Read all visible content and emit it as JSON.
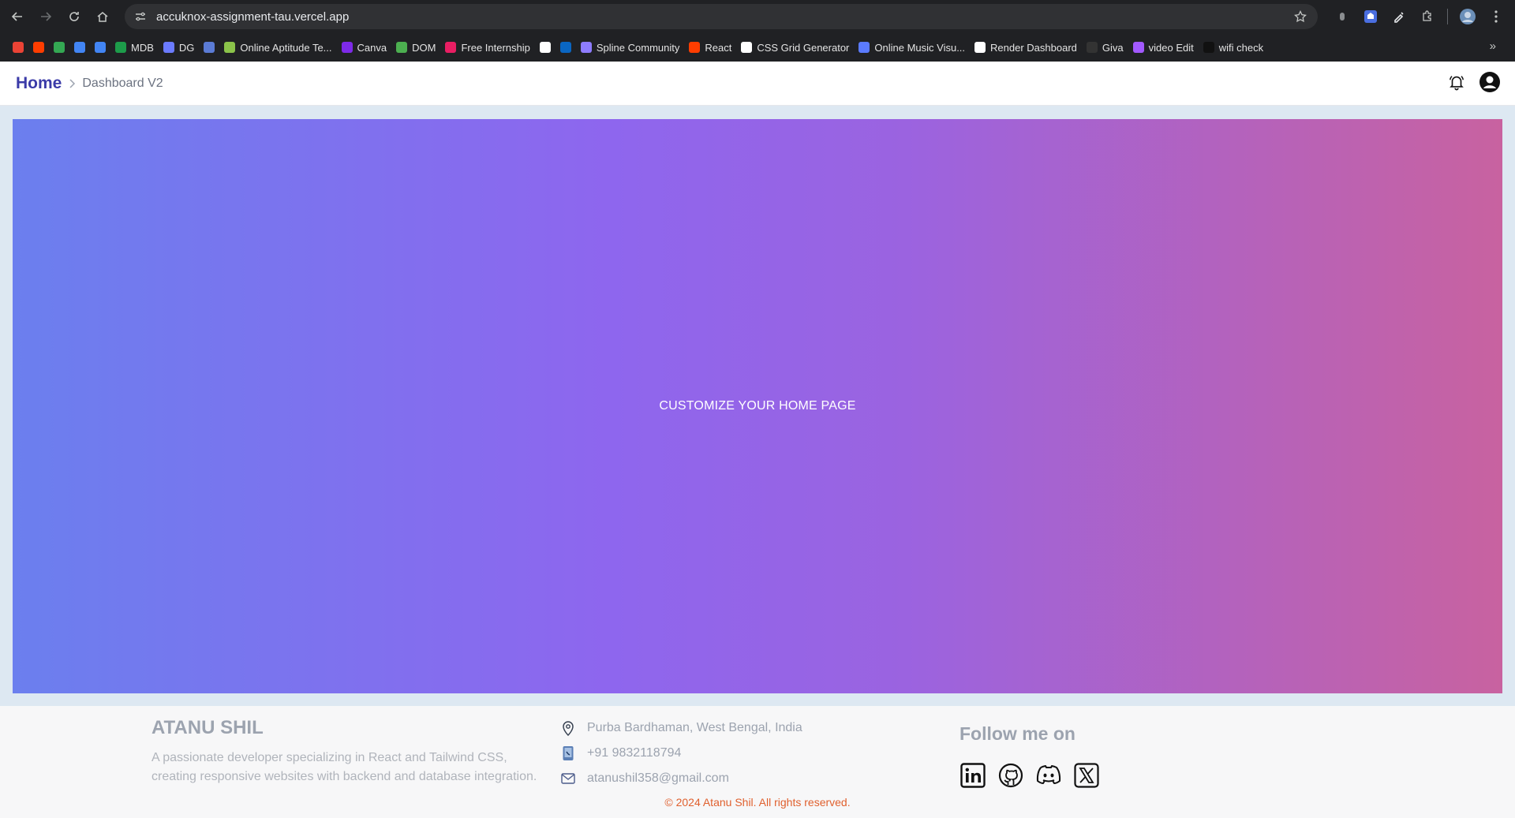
{
  "browser": {
    "url": "accuknox-assignment-tau.vercel.app",
    "bookmarks": [
      {
        "label": "",
        "color": "#ea4335"
      },
      {
        "label": "",
        "color": "#ff3d00"
      },
      {
        "label": "",
        "color": "#34a853"
      },
      {
        "label": "",
        "color": "#4285f4"
      },
      {
        "label": "",
        "color": "#4285f4"
      },
      {
        "label": "MDB",
        "color": "#1d9c4a"
      },
      {
        "label": "DG",
        "color": "#6b7bff"
      },
      {
        "label": "",
        "color": "#5b7bd5"
      },
      {
        "label": "Online Aptitude Te...",
        "color": "#8bc34a"
      },
      {
        "label": "Canva",
        "color": "#7d2ae8"
      },
      {
        "label": "DOM",
        "color": "#4caf50"
      },
      {
        "label": "Free Internship",
        "color": "#e91e63"
      },
      {
        "label": "",
        "color": "#ffffff"
      },
      {
        "label": "",
        "color": "#0a66c2"
      },
      {
        "label": "Spline Community",
        "color": "#8e7cff"
      },
      {
        "label": "React",
        "color": "#ff3d00"
      },
      {
        "label": "CSS Grid Generator",
        "color": "#ffffff"
      },
      {
        "label": "Online Music Visu...",
        "color": "#5b7bff"
      },
      {
        "label": "Render Dashboard",
        "color": "#ffffff"
      },
      {
        "label": "Giva",
        "color": "#333333"
      },
      {
        "label": "video Edit",
        "color": "#a259ff"
      },
      {
        "label": "wifi check",
        "color": "#111111"
      }
    ]
  },
  "header": {
    "home_label": "Home",
    "current_label": "Dashboard V2"
  },
  "hero": {
    "text": "CUSTOMIZE YOUR HOME PAGE",
    "gradient_start": "#6b7fee",
    "gradient_end": "#c862a0"
  },
  "footer": {
    "name": "ATANU SHIL",
    "description": "A passionate developer specializing in React and Tailwind CSS, creating responsive websites with backend and database integration.",
    "location": "Purba Bardhaman, West Bengal, India",
    "phone": "+91 9832118794",
    "email": "atanushil358@gmail.com",
    "follow_title": "Follow me on",
    "socials": [
      "linkedin-icon",
      "github-icon",
      "discord-icon",
      "x-icon"
    ],
    "copyright": "© 2024 Atanu Shil. All rights reserved."
  }
}
